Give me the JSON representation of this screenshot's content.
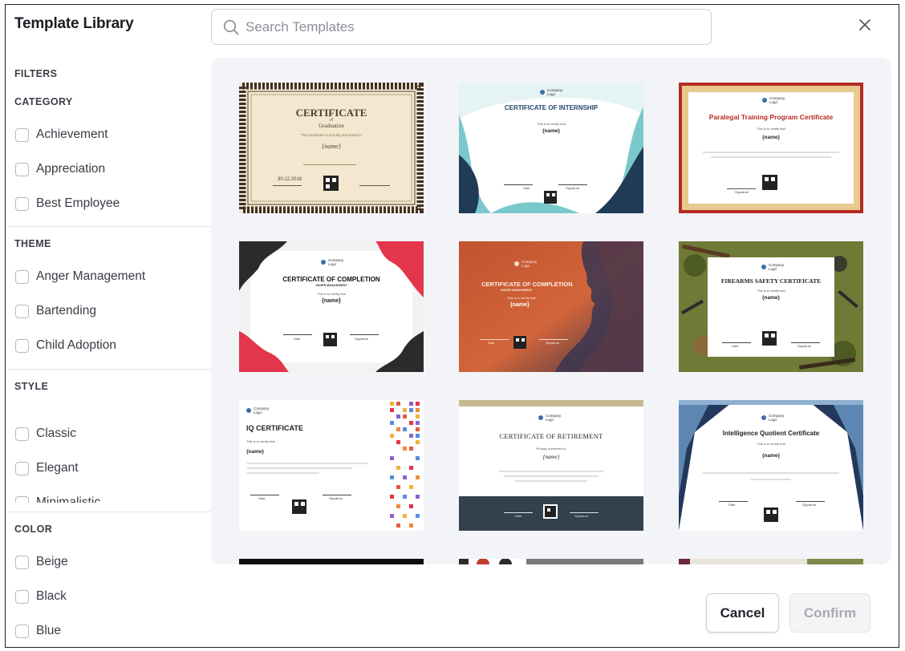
{
  "header": {
    "title": "Template Library"
  },
  "search": {
    "placeholder": "Search Templates",
    "icon": "search-icon"
  },
  "sidebar": {
    "filters_label": "FILTERS",
    "category": {
      "title": "CATEGORY",
      "options": [
        "Achievement",
        "Appreciation",
        "Best Employee"
      ]
    },
    "theme": {
      "title": "THEME",
      "options": [
        "Anger Management",
        "Bartending",
        "Child Adoption"
      ]
    },
    "style": {
      "title": "STYLE",
      "options": [
        "Classic",
        "Elegant",
        "Minimalistic"
      ]
    },
    "color": {
      "title": "COLOR",
      "options": [
        "Beige",
        "Black",
        "Blue"
      ]
    }
  },
  "templates": [
    {
      "title": "CERTIFICATE",
      "subtitle": "Graduation",
      "of": "of",
      "line": "This certificate is proudly presented to",
      "name": "{name}",
      "date": "30.12.2018"
    },
    {
      "logo": "Company Logo",
      "title": "CERTIFICATE OF INTERNSHIP",
      "line": "This is to certify that",
      "name": "{name}",
      "date_label": "Date",
      "sig_label": "Signature"
    },
    {
      "logo": "Company Logo",
      "title": "Paralegal Training Program Certificate",
      "line": "This is to certify that",
      "name": "{name}",
      "sig_label": "Signature"
    },
    {
      "logo": "Company Logo",
      "title": "CERTIFICATE OF COMPLETION",
      "subtitle": "ANGER MANAGEMENT",
      "line": "This is to certify that",
      "name": "{name}",
      "date_label": "Date",
      "sig_label": "Signature"
    },
    {
      "logo": "Company Logo",
      "title": "CERTIFICATE OF COMPLETION",
      "subtitle": "ANGER MANAGEMENT",
      "line": "This is to certify that",
      "name": "{name}",
      "date_label": "Date",
      "sig_label": "Signature"
    },
    {
      "logo": "Company Logo",
      "title": "FIREARMS SAFETY CERTIFICATE",
      "line": "This is to certify that",
      "name": "{name}",
      "date_label": "Date",
      "sig_label": "Signature"
    },
    {
      "logo": "Company Logo",
      "title": "IQ CERTIFICATE",
      "line": "This is to certify that",
      "name": "{name}",
      "date_label": "Date",
      "sig_label": "Signature"
    },
    {
      "logo": "Company Logo",
      "title": "CERTIFICATE OF RETIREMENT",
      "line": "Proudly presented to",
      "name": "{name}",
      "date_label": "Date",
      "sig_label": "Signature"
    },
    {
      "logo": "Company Logo",
      "title": "Intelligence Quotient Certificate",
      "line": "This is to certify that",
      "name": "{name}",
      "date_label": "Date",
      "sig_label": "Signature"
    }
  ],
  "footer": {
    "cancel_label": "Cancel",
    "confirm_label": "Confirm"
  },
  "colors": {
    "accent_red": "#b52a23",
    "teal": "#6cc5c9",
    "navy": "#23385a",
    "frame_gold": "#e9c98f"
  }
}
